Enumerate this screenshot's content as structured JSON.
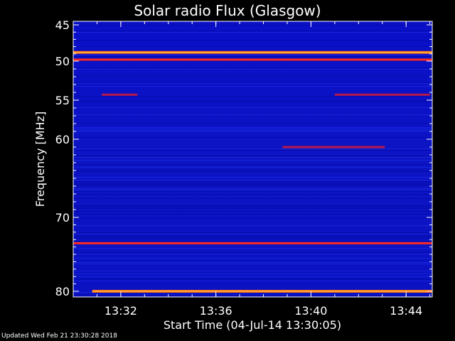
{
  "chart_data": {
    "type": "heatmap",
    "title": "Solar radio Flux (Glasgow)",
    "xlabel": "Start Time (04-Jul-14 13:30:05)",
    "ylabel_main": "Frequency",
    "ylabel_unit": "MHz",
    "x_ticks": [
      "13:32",
      "13:36",
      "13:40",
      "13:44"
    ],
    "x_tick_minutes": [
      2,
      6,
      10,
      14
    ],
    "xlim_minutes": [
      0,
      15.1
    ],
    "y_ticks": [
      "45",
      "50",
      "55",
      "60",
      "70",
      "80"
    ],
    "y_tick_values": [
      45,
      50,
      55,
      60,
      70,
      80
    ],
    "ylim_mhz": [
      45,
      80
    ],
    "grid": false,
    "colormap": [
      "#0000c0",
      "#1f2fd8",
      "#c01040",
      "#ff3010",
      "#ff9020",
      "#ffff60"
    ],
    "bright_bands_mhz": [
      {
        "freq": 48.8,
        "t_start": 0.0,
        "t_end": 15.1,
        "level": "high"
      },
      {
        "freq": 49.8,
        "t_start": 0.0,
        "t_end": 15.1,
        "level": "medium"
      },
      {
        "freq": 73.5,
        "t_start": 0.0,
        "t_end": 15.1,
        "level": "medium"
      },
      {
        "freq": 80.0,
        "t_start": 0.8,
        "t_end": 15.1,
        "level": "high"
      },
      {
        "freq": 61.0,
        "t_start": 8.8,
        "t_end": 13.1,
        "level": "low"
      },
      {
        "freq": 54.3,
        "t_start": 1.2,
        "t_end": 2.7,
        "level": "low"
      },
      {
        "freq": 54.3,
        "t_start": 11.0,
        "t_end": 15.0,
        "level": "low"
      }
    ]
  },
  "footer": {
    "updated": "Updated Wed Feb 21 23:30:28 2018"
  }
}
